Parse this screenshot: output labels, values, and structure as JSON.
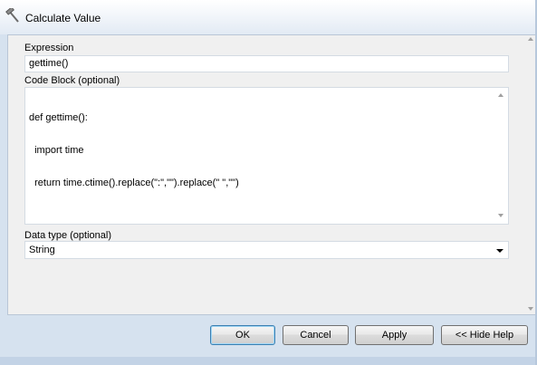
{
  "window": {
    "title": "Calculate Value",
    "icon": "hammer-icon"
  },
  "expression": {
    "label": "Expression",
    "value": "gettime()"
  },
  "code_block": {
    "label": "Code Block (optional)",
    "lines": [
      "def gettime():",
      "  import time",
      "  return time.ctime().replace(\":\",\"\").replace(\" \",\"\")"
    ]
  },
  "data_type": {
    "label": "Data type (optional)",
    "selected": "String"
  },
  "buttons": {
    "ok": "OK",
    "cancel": "Cancel",
    "apply": "Apply",
    "hide_help": "<< Hide Help"
  }
}
